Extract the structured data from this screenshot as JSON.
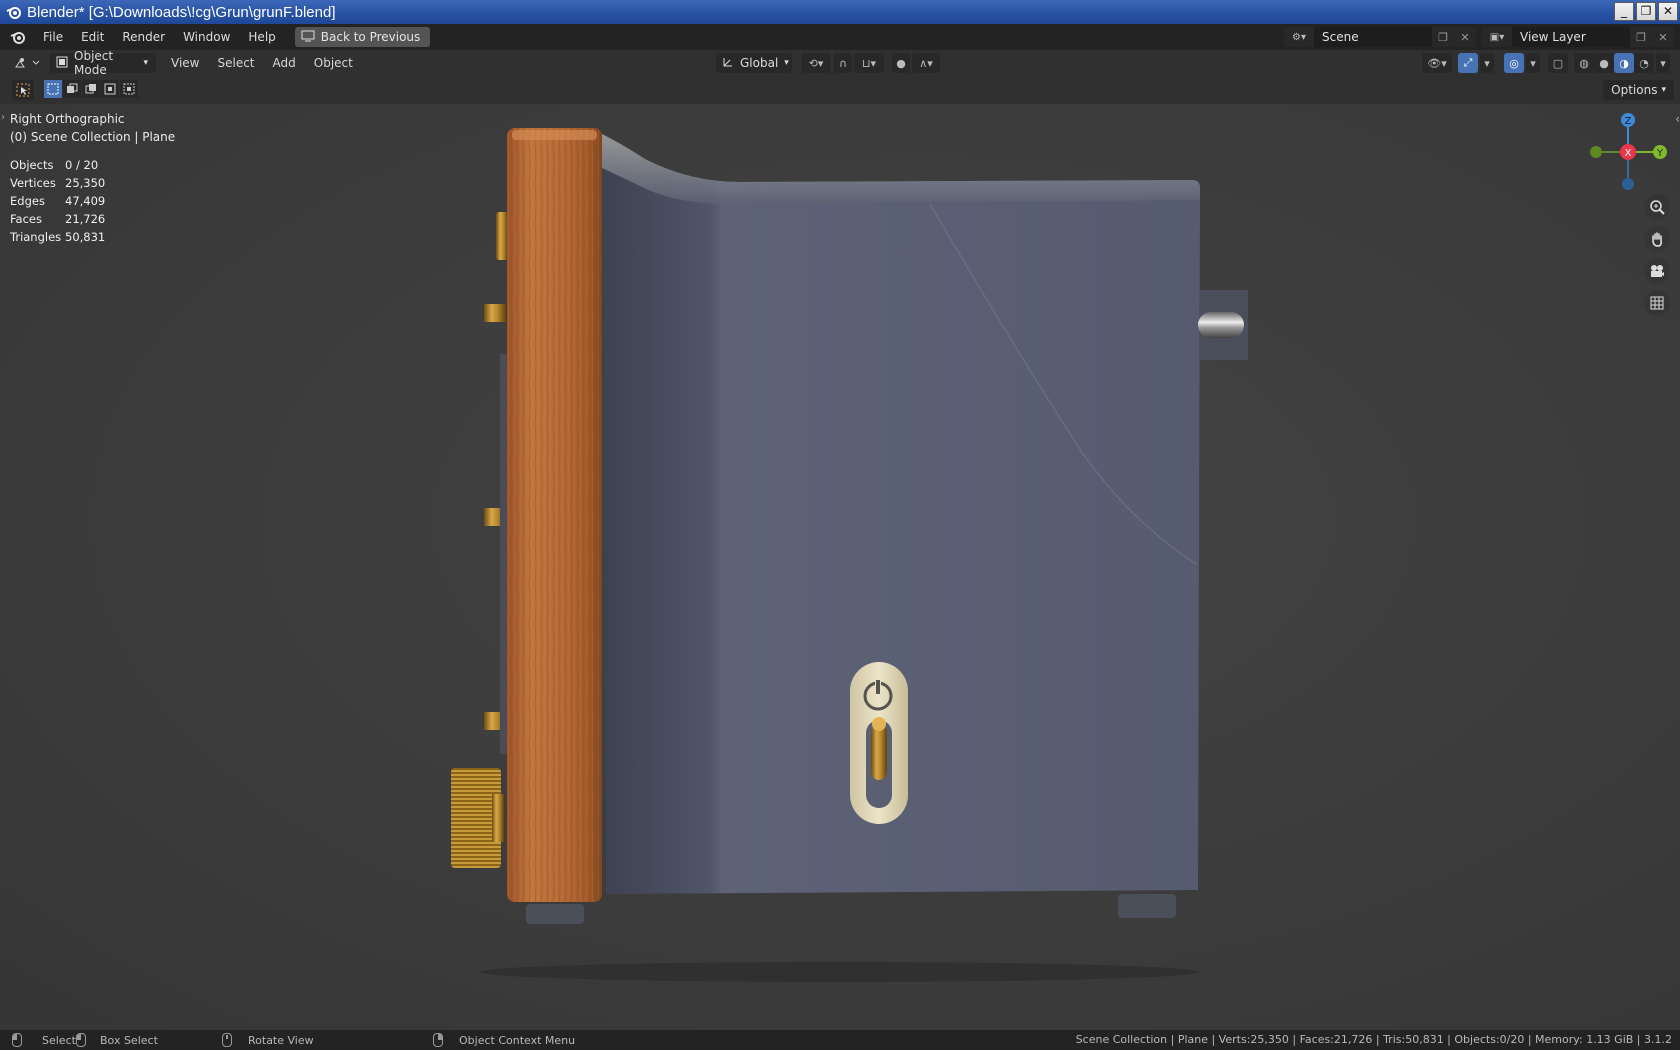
{
  "window": {
    "title": "Blender* [G:\\Downloads\\!cg\\Grun\\grunF.blend]",
    "controls": [
      "_",
      "❐",
      "✕"
    ]
  },
  "menubar": {
    "items": [
      "File",
      "Edit",
      "Render",
      "Window",
      "Help"
    ],
    "back_label": "Back to Previous",
    "scene": "Scene",
    "view_layer": "View Layer"
  },
  "header": {
    "mode": "Object Mode",
    "menus": [
      "View",
      "Select",
      "Add",
      "Object"
    ],
    "orientation": "Global",
    "options_label": "Options"
  },
  "viewport": {
    "view_name": "Right Orthographic",
    "collection": "(0) Scene Collection | Plane",
    "stats": [
      {
        "label": "Objects",
        "value": "0 / 20"
      },
      {
        "label": "Vertices",
        "value": "25,350"
      },
      {
        "label": "Edges",
        "value": "47,409"
      },
      {
        "label": "Faces",
        "value": "21,726"
      },
      {
        "label": "Triangles",
        "value": "50,831"
      }
    ],
    "gizmo": {
      "z": "Z",
      "x": "X",
      "y": "Y"
    },
    "colors": {
      "x": "#e8374a",
      "y": "#7fb92e",
      "z": "#3e8ad8",
      "accent": "#4772b3"
    }
  },
  "statusbar": {
    "select": "Select",
    "box_select": "Box Select",
    "rotate": "Rotate View",
    "context": "Object Context Menu",
    "info": "Scene Collection | Plane | Verts:25,350 | Faces:21,726 | Tris:50,831 | Objects:0/20 | Memory: 1.13 GiB | 3.1.2"
  }
}
